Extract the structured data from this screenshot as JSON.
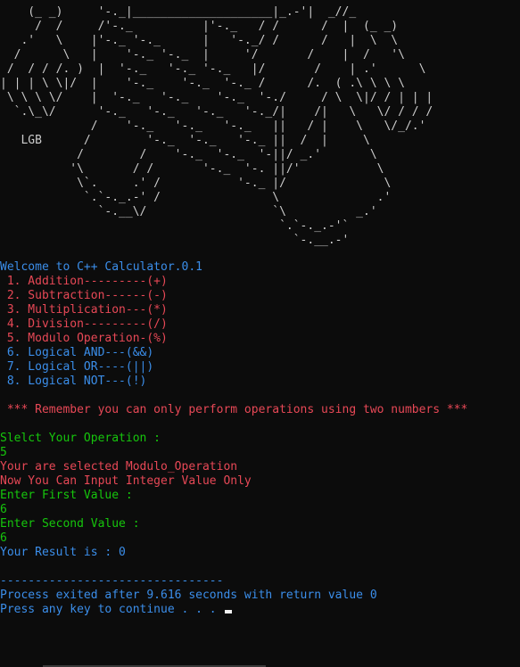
{
  "ascii_art": "    (_ _)     '-._|____________________|_.-'|  _//_\n     /  /     /'-._          |'-._   / /      /  |  (_ _)\n   .'   \\    |'-._ '-._      |   '-._/ /      /   |  \\  \\\n  /      \\   |    '-._ '-._  |     '/       /    |  /   '\\\n /  / / /. )  |  '-._   '-._ '-._   |/       /    | .'      \\\n| | | \\ \\|/  |    '-._    '-._  '-._ /      /.  ( .\\ \\ \\ \\\n \\ \\ \\ \\/    |  '-._   '-._    '-._  '-./     / \\  \\|/ / | | |\n  `.\\_\\/      '-._   '-._   '-._   '-._/|    /|   \\   \\/ / / /\n             /    '-._   '-._   '-._   ||   / |    \\   \\/_/.'\n   LGB      /        '-._  '-._   '-._ ||  /  |     \\\n           /        /    '-._  '-._  '-||/ _.'       \\\n          '\\       / /       '-._  '-. ||/'           \\\n           \\`.     .' /           '-._ |/              \\\n            `.`-._.-' /                \\              .'\n              `-.__\\/                  `\\          _.'\n                                        `.`-._.-'`\n                                          `-.__.-'",
  "welcome": "Welcome to C++ Calculator.0.1",
  "menu": [
    {
      "label": " 1. Addition---------(+)",
      "color": "#e74856"
    },
    {
      "label": " 2. Subtraction------(-)",
      "color": "#e74856"
    },
    {
      "label": " 3. Multiplication---(*)",
      "color": "#e74856"
    },
    {
      "label": " 4. Division---------(/)",
      "color": "#e74856"
    },
    {
      "label": " 5. Modulo Operation-(%)",
      "color": "#e74856"
    },
    {
      "label": " 6. Logical AND---(&&)",
      "color": "#3b8eea"
    },
    {
      "label": " 7. Logical OR----(||)",
      "color": "#3b8eea"
    },
    {
      "label": " 8. Logical NOT---(!)",
      "color": "#3b8eea"
    }
  ],
  "notice": " *** Remember you can only perform operations using two numbers ***",
  "select_prompt": "Slelct Your Operation :",
  "select_value": "5",
  "selected_msg": "Your are selected Modulo_Operation",
  "integer_msg": "Now You Can Input Integer Value Only",
  "first_prompt": "Enter First Value :",
  "first_value": "6",
  "second_prompt": "Enter Second Value :",
  "second_value": "6",
  "result": "Your Result is : 0",
  "separator": "--------------------------------",
  "exit_msg": "Process exited after 9.616 seconds with return value 0",
  "continue_msg": "Press any key to continue . . . ",
  "colors": {
    "background": "#0c0c0c",
    "blue": "#3b8eea",
    "red": "#e74856",
    "green": "#16c60c",
    "art": "#cccccc"
  }
}
